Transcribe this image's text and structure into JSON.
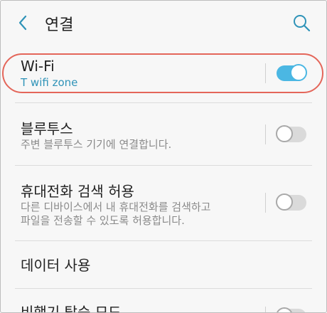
{
  "header": {
    "back_icon": "chevron-left-icon",
    "title": "연결",
    "search_icon": "search-icon"
  },
  "colors": {
    "accent": "#2f93b8",
    "toggle_on": "#4bb7e3",
    "highlight": "#e4665a"
  },
  "items": [
    {
      "label": "Wi-Fi",
      "sublabel": "T wifi zone",
      "toggle": true
    },
    {
      "label": "블루투스",
      "sublabel": "주변 블루투스 기기에 연결합니다.",
      "toggle": false
    },
    {
      "label": "휴대전화 검색 허용",
      "sublabel_line1": "다른 디바이스에서 내 휴대전화를 검색하고",
      "sublabel_line2": "파일을 전송할 수 있도록 허용합니다.",
      "toggle": false
    },
    {
      "label": "데이터 사용"
    },
    {
      "label": "비행기 탑승 모드",
      "toggle": false
    }
  ]
}
